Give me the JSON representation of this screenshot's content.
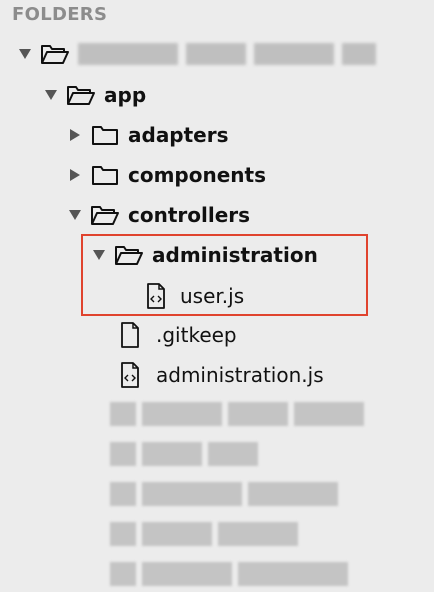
{
  "sidebar": {
    "header": "FOLDERS"
  },
  "tree": {
    "root": {
      "name_redacted": true
    },
    "app": "app",
    "adapters": "adapters",
    "components": "components",
    "controllers": "controllers",
    "administration": "administration",
    "user_js": "user.js",
    "gitkeep": ".gitkeep",
    "administration_js": "administration.js"
  },
  "highlight_color": "#e0432e"
}
